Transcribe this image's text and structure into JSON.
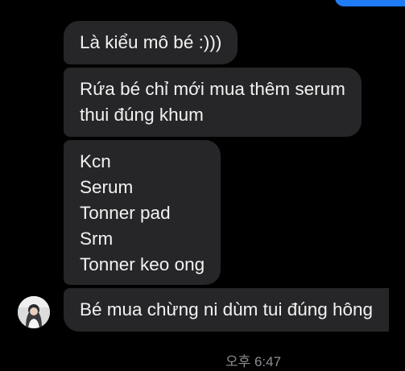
{
  "messages": [
    {
      "lines": [
        "Là kiểu mô bé :)))"
      ]
    },
    {
      "lines": [
        "Rứa bé chỉ mới mua thêm serum",
        "thui đúng khum"
      ]
    },
    {
      "lines": [
        "Kcn",
        "Serum",
        "Tonner pad",
        "Srm",
        "Tonner keo ong"
      ]
    },
    {
      "lines": [
        "Bé mua chừng ni dùm tui đúng hông"
      ]
    }
  ],
  "timestamp": "오후 6:47",
  "colors": {
    "background": "#000000",
    "received_bubble": "#262628",
    "sent_bubble": "#1f7cf5",
    "timestamp_text": "#8e8e93"
  },
  "icons": {
    "avatar": "contact-avatar"
  }
}
